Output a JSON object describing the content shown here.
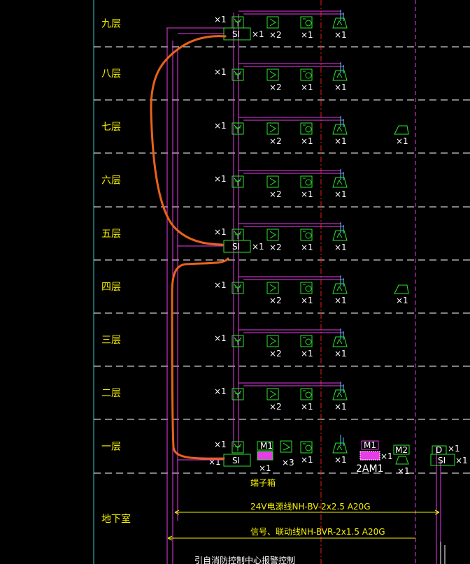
{
  "floors": [
    "九层",
    "八层",
    "七层",
    "六层",
    "五层",
    "四层",
    "三层",
    "二层",
    "一层",
    "地下室"
  ],
  "device_counts": {
    "smoke_detector": "×1",
    "manual_alarm": "×2",
    "manual_alarm_ground": "×3",
    "hydrant_button": "×1",
    "sounder": "×1",
    "aux_device": "×1",
    "si_module": "×1"
  },
  "si_label": "SI",
  "d_label": "D",
  "m1_label": "M1",
  "m2_label": "M2",
  "panel_2am1": "2AM1",
  "terminal_box": "端子箱",
  "cable_power": "24V电源线NH-BV-2x2.5 A20G",
  "cable_signal": "信号、联动线NH-BVR-2x1.5 A20G",
  "bottom_note": "引自消防控制中心报警控制",
  "colors": {
    "background": "#000000",
    "floor_text": "#f5f000",
    "device_green": "#29e829",
    "wire_magenta": "#e83ce8",
    "riser_cyan": "#4ac8ff",
    "red_dash": "#e81c1c",
    "orange_markup": "#e8621a",
    "grid_cyan": "#3fc7c7"
  }
}
